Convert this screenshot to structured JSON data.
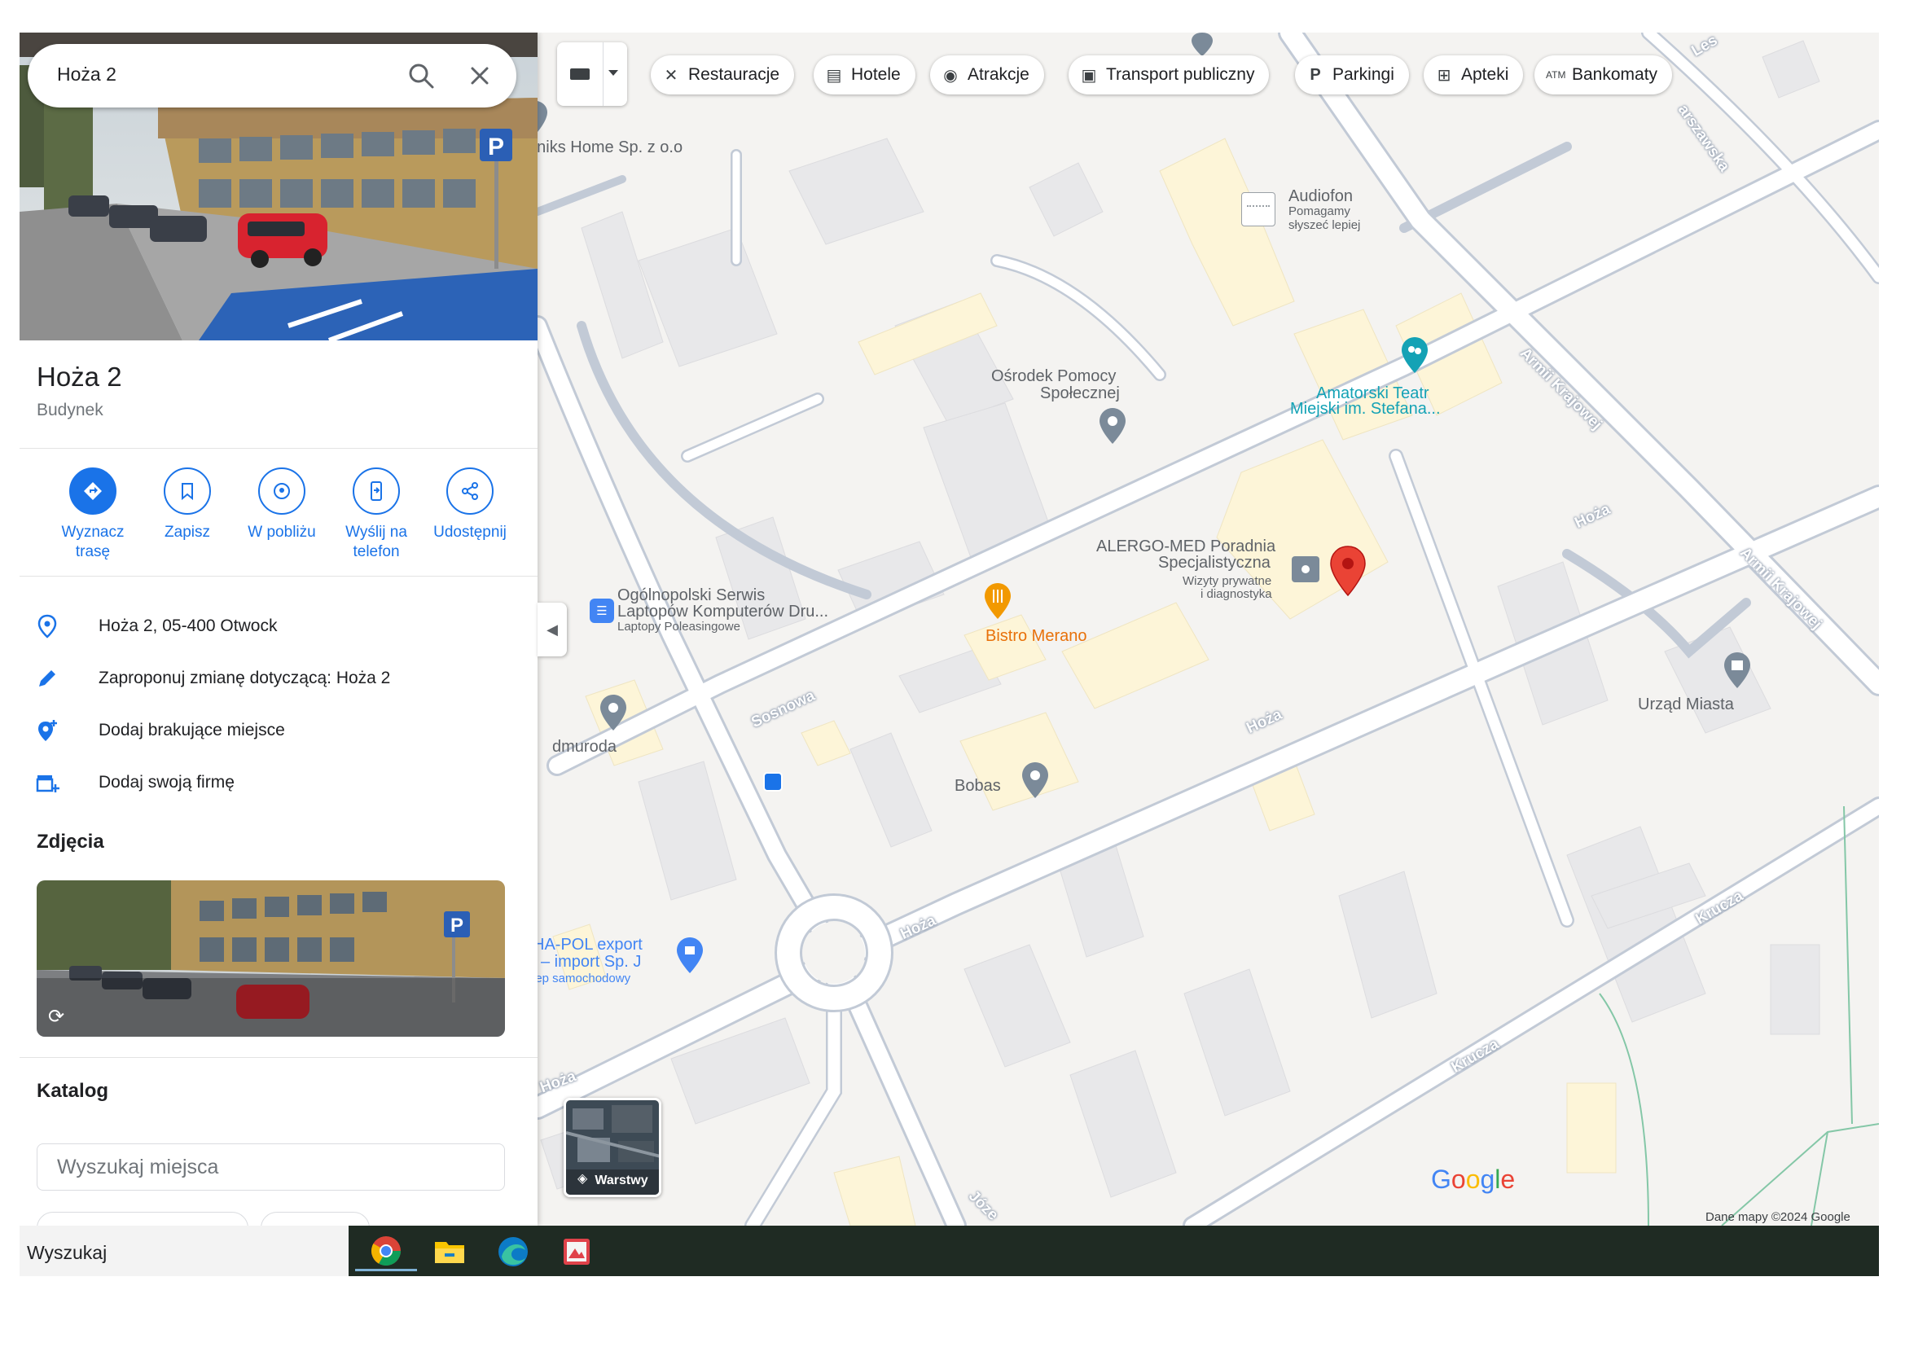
{
  "search": {
    "query": "Hoża 2"
  },
  "place": {
    "title": "Hoża 2",
    "category": "Budynek"
  },
  "actions": [
    {
      "label": "Wyznacz trasę",
      "icon": "directions-icon"
    },
    {
      "label": "Zapisz",
      "icon": "bookmark-icon"
    },
    {
      "label": "W pobliżu",
      "icon": "nearby-icon"
    },
    {
      "label": "Wyślij na telefon",
      "icon": "send-to-phone-icon"
    },
    {
      "label": "Udostępnij",
      "icon": "share-icon"
    }
  ],
  "info_rows": [
    {
      "text": "Hoża 2, 05-400 Otwock",
      "icon": "location-pin-icon"
    },
    {
      "text": "Zaproponuj zmianę dotyczącą: Hoża 2",
      "icon": "pencil-icon"
    },
    {
      "text": "Dodaj brakujące miejsce",
      "icon": "add-place-icon"
    },
    {
      "text": "Dodaj swoją firmę",
      "icon": "add-business-icon"
    }
  ],
  "sections": {
    "photos": "Zdjęcia",
    "catalog": "Katalog"
  },
  "catalog": {
    "placeholder": "Wyszukaj miejsca"
  },
  "chips": [
    {
      "label": "Restauracje",
      "icon": "fork-knife-icon"
    },
    {
      "label": "Hotele",
      "icon": "bed-icon"
    },
    {
      "label": "Atrakcje",
      "icon": "camera-icon"
    },
    {
      "label": "Transport publiczny",
      "icon": "bus-icon"
    },
    {
      "label": "Parkingi",
      "icon": "parking-icon"
    },
    {
      "label": "Apteki",
      "icon": "pharmacy-icon"
    },
    {
      "label": "Bankomaty",
      "icon": "atm-icon"
    }
  ],
  "map": {
    "pois": {
      "tekniks": "eniks Home Sp. z o.o",
      "audiofon": "Audiofon",
      "audiofon_sub1": "Pomagamy",
      "audiofon_sub2": "słyszeć lepiej",
      "osrodek1": "Ośrodek Pomocy",
      "osrodek2": "Społecznej",
      "teatr1": "Amatorski Teatr",
      "teatr2": "Miejski im. Stefana...",
      "alergo1": "ALERGO-MED Poradnia",
      "alergo2": "Specjalistyczna",
      "alergo_sub1": "Wizyty prywatne",
      "alergo_sub2": "i diagnostyka",
      "serwis1": "Ogólnopolski Serwis",
      "serwis2": "Laptopów Komputerów Dru...",
      "serwis_sub": "Laptopy Poleasingowe",
      "bistro": "Bistro Merano",
      "dmuroda": "dmuroda",
      "bobas": "Bobas",
      "urzad": "Urząd Miasta",
      "hapol1": "HA-POL export",
      "hapol2": "– import Sp. J",
      "hapol_sub": "lep samochodowy"
    },
    "streets": {
      "sosnowa": "Sosnowa",
      "hoza": "Hoża",
      "armii": "Armii Krajowej",
      "warszawska": "arszawska",
      "krucza": "Krucza",
      "jozef": "Józe",
      "les": "Les"
    },
    "layers_label": "Warstwy",
    "logo": "Google",
    "attribution": "Dane mapy ©2024 Google"
  },
  "taskbar": {
    "search": "Wyszukaj",
    "apps": [
      "chrome-icon",
      "file-explorer-icon",
      "edge-icon",
      "photo-app-icon"
    ]
  },
  "colors": {
    "accent": "#1a73e8",
    "pin_red": "#ea4335",
    "teal": "#14a2b5",
    "orange": "#e8710a"
  }
}
